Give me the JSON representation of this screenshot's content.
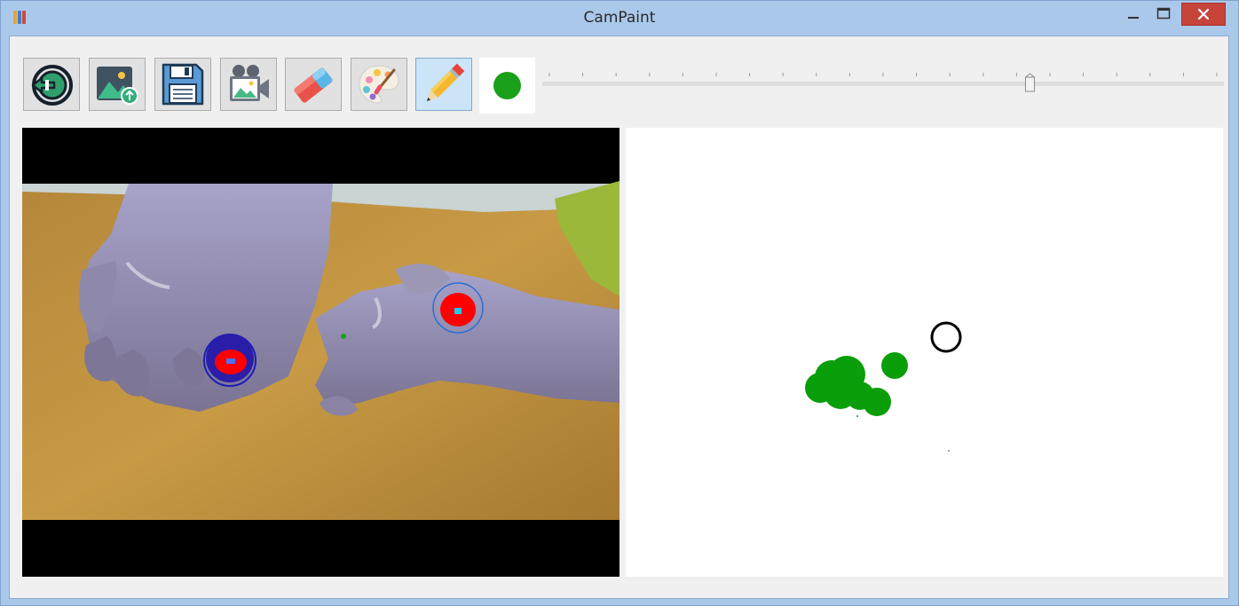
{
  "window": {
    "title": "CamPaint",
    "minimize_symbol": "—",
    "maximize_symbol": "☐",
    "close_symbol": "✕"
  },
  "toolbar": {
    "tools": [
      {
        "id": "exit",
        "icon": "exit-icon"
      },
      {
        "id": "load-image",
        "icon": "image-upload-icon"
      },
      {
        "id": "save",
        "icon": "floppy-disk-icon"
      },
      {
        "id": "camera",
        "icon": "video-camera-icon"
      },
      {
        "id": "eraser",
        "icon": "eraser-icon"
      },
      {
        "id": "color-palette",
        "icon": "palette-icon"
      },
      {
        "id": "pencil",
        "icon": "pencil-icon",
        "active": true
      }
    ],
    "current_color": "#1aa01a"
  },
  "brush_size_slider": {
    "value_fraction": 0.72,
    "tick_count": 21
  },
  "panels": {
    "camera_feed": "live-webcam-feed",
    "drawing_canvas": "paint-canvas"
  },
  "colors": {
    "stroke": "#0a9e0a",
    "marker_detect": "#ff0000",
    "marker_ring": "#1c1cb8",
    "cursor": "#000000"
  }
}
